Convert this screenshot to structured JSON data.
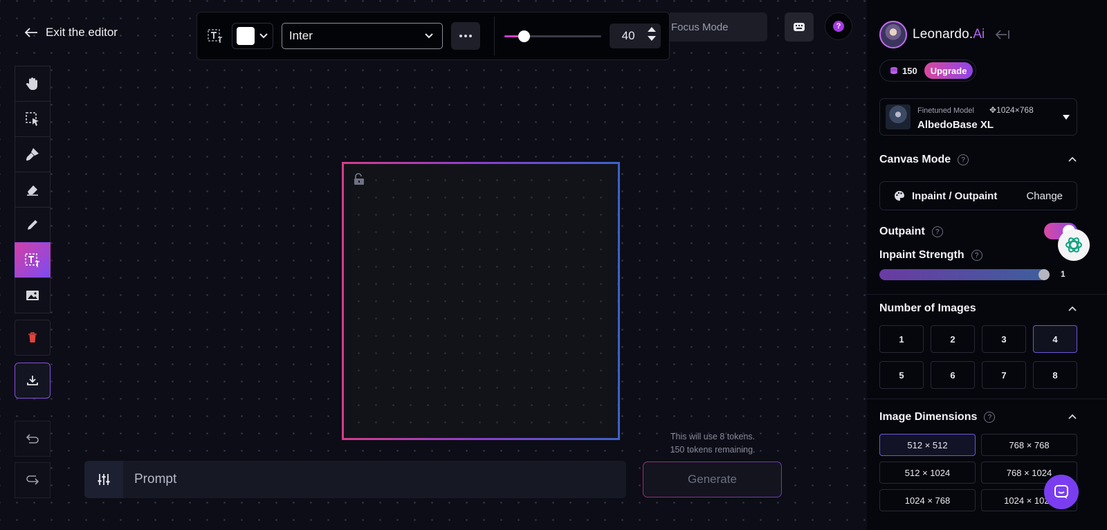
{
  "editor": {
    "exit_label": "Exit the editor",
    "focus_mode_label": "Focus Mode",
    "help_symbol": "?"
  },
  "toolbar": {
    "text_color": "#ffffff",
    "font_family_value": "Inter",
    "font_size_value": "40",
    "font_size_fraction": 0.16
  },
  "tools": [
    {
      "name": "pan-tool",
      "icon": "hand-icon"
    },
    {
      "name": "select-tool",
      "icon": "select-icon"
    },
    {
      "name": "draw-mask-tool",
      "icon": "brush-icon"
    },
    {
      "name": "erase-tool",
      "icon": "eraser-icon"
    },
    {
      "name": "sketch-tool",
      "icon": "pencil-icon"
    },
    {
      "name": "text-tool",
      "icon": "text-icon",
      "active": true
    },
    {
      "name": "image-tool",
      "icon": "image-icon"
    },
    {
      "name": "delete-tool",
      "icon": "trash-icon"
    },
    {
      "name": "download-tool",
      "icon": "download-icon"
    }
  ],
  "prompt": {
    "placeholder": "Prompt",
    "token_info_line1": "This will use 8 tokens.",
    "token_info_line2": "150 tokens remaining.",
    "generate_label": "Generate"
  },
  "panel": {
    "brand_name": "Leonardo.",
    "brand_suffix": "Ai",
    "token_count": "150",
    "upgrade_label": "Upgrade",
    "model": {
      "kind": "Finetuned Model",
      "dimensions": "1024×768",
      "name": "AlbedoBase XL"
    },
    "canvas_mode_title": "Canvas Mode",
    "canvas_mode_value": "Inpaint / Outpaint",
    "canvas_mode_change": "Change",
    "outpaint_label": "Outpaint",
    "outpaint_on": true,
    "inpaint_strength_label": "Inpaint Strength",
    "inpaint_strength_value": "1",
    "num_images_title": "Number of Images",
    "num_images_options": [
      "1",
      "2",
      "3",
      "4",
      "5",
      "6",
      "7",
      "8"
    ],
    "num_images_selected": "4",
    "dimensions_title": "Image Dimensions",
    "dimension_options": [
      "512 × 512",
      "768 × 768",
      "512 × 1024",
      "768 × 1024",
      "1024 × 768",
      "1024 × 1024"
    ],
    "dimension_selected": "512 × 512"
  },
  "colors": {
    "accent_pink": "#d9489e",
    "accent_purple": "#8f45e8",
    "background": "#0b0c14"
  }
}
